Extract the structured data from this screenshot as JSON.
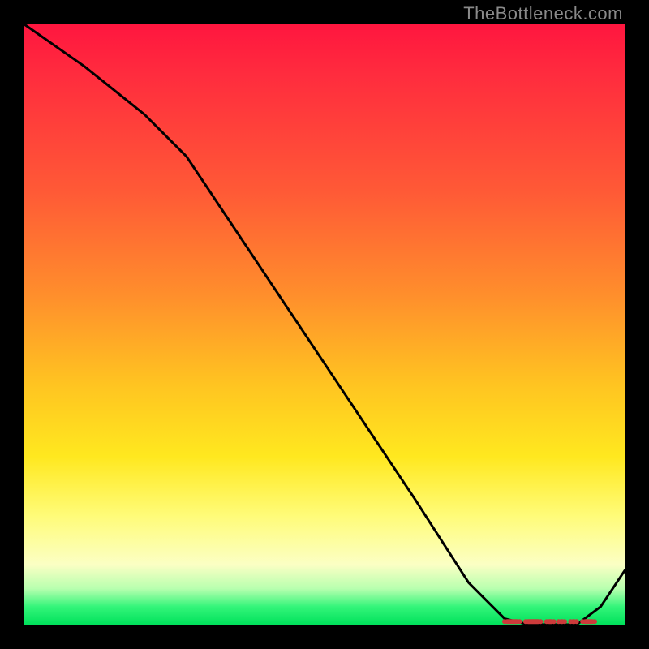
{
  "watermark": "TheBottleneck.com",
  "chart_data": {
    "type": "line",
    "title": "",
    "xlabel": "",
    "ylabel": "",
    "xlim": [
      0,
      100
    ],
    "ylim": [
      0,
      100
    ],
    "grid": false,
    "series": [
      {
        "name": "curve",
        "color": "#000000",
        "x": [
          0,
          10,
          20,
          27,
          35,
          45,
          55,
          65,
          74,
          80,
          84,
          88,
          92,
          96,
          100
        ],
        "y": [
          100,
          93,
          85,
          78,
          66,
          51,
          36,
          21,
          7,
          1,
          0,
          0,
          0,
          3,
          9
        ]
      }
    ],
    "reference_band": {
      "name": "reference-markers",
      "color": "#cc3b3b",
      "y": 0.5,
      "x_start": 80,
      "x_end": 95,
      "segments": [
        [
          80,
          82.5
        ],
        [
          83.5,
          86
        ],
        [
          87,
          88.2
        ],
        [
          89,
          90
        ],
        [
          91,
          92
        ],
        [
          93,
          95
        ]
      ]
    }
  }
}
